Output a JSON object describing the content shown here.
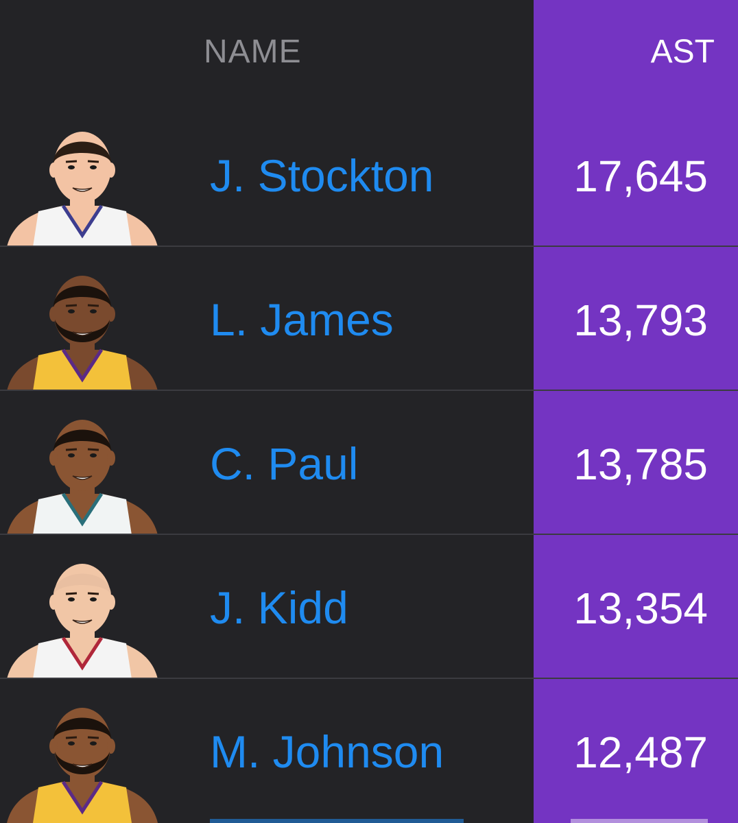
{
  "header": {
    "name_label": "NAME",
    "stat_label": "AST"
  },
  "colors": {
    "background": "#232326",
    "accent_column": "#7434c2",
    "name_link": "#1f8bf0",
    "header_muted": "#8e8e93"
  },
  "rows": [
    {
      "name": "J. Stockton",
      "ast": "17,645",
      "skin": "#f3c3a4",
      "hair": "#2b1d14",
      "jersey": "#f4f4f4",
      "trim": "#3d3d8f",
      "beard": false,
      "icon": "player-headshot-icon"
    },
    {
      "name": "L. James",
      "ast": "13,793",
      "skin": "#7a4a2e",
      "hair": "#1b120c",
      "jersey": "#f3c13a",
      "trim": "#5b2a86",
      "beard": true,
      "icon": "player-headshot-icon"
    },
    {
      "name": "C. Paul",
      "ast": "13,785",
      "skin": "#8a5533",
      "hair": "#1b120c",
      "jersey": "#f1f4f4",
      "trim": "#2a6f7a",
      "beard": false,
      "icon": "player-headshot-icon"
    },
    {
      "name": "J. Kidd",
      "ast": "13,354",
      "skin": "#f1c6a6",
      "hair": "#e9bfa1",
      "jersey": "#f4f4f4",
      "trim": "#b0273a",
      "beard": false,
      "icon": "player-headshot-icon"
    },
    {
      "name": "M. Johnson",
      "ast": "12,487",
      "skin": "#8a5533",
      "hair": "#1b120c",
      "jersey": "#f3c13a",
      "trim": "#5b2a86",
      "beard": true,
      "icon": "player-headshot-icon"
    }
  ]
}
